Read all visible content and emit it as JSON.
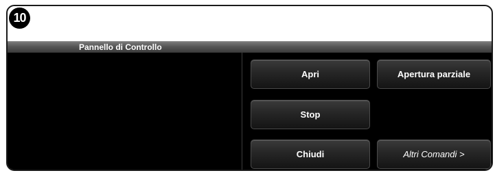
{
  "step_badge": "10",
  "panel": {
    "title": "Pannello di Controllo"
  },
  "buttons": {
    "open": "Apri",
    "partial_open": "Apertura parziale",
    "stop": "Stop",
    "close": "Chiudi",
    "more_commands": "Altri Comandi >"
  },
  "colors": {
    "background": "#000000",
    "title_bar": "#555555",
    "button_text": "#ffffff"
  }
}
